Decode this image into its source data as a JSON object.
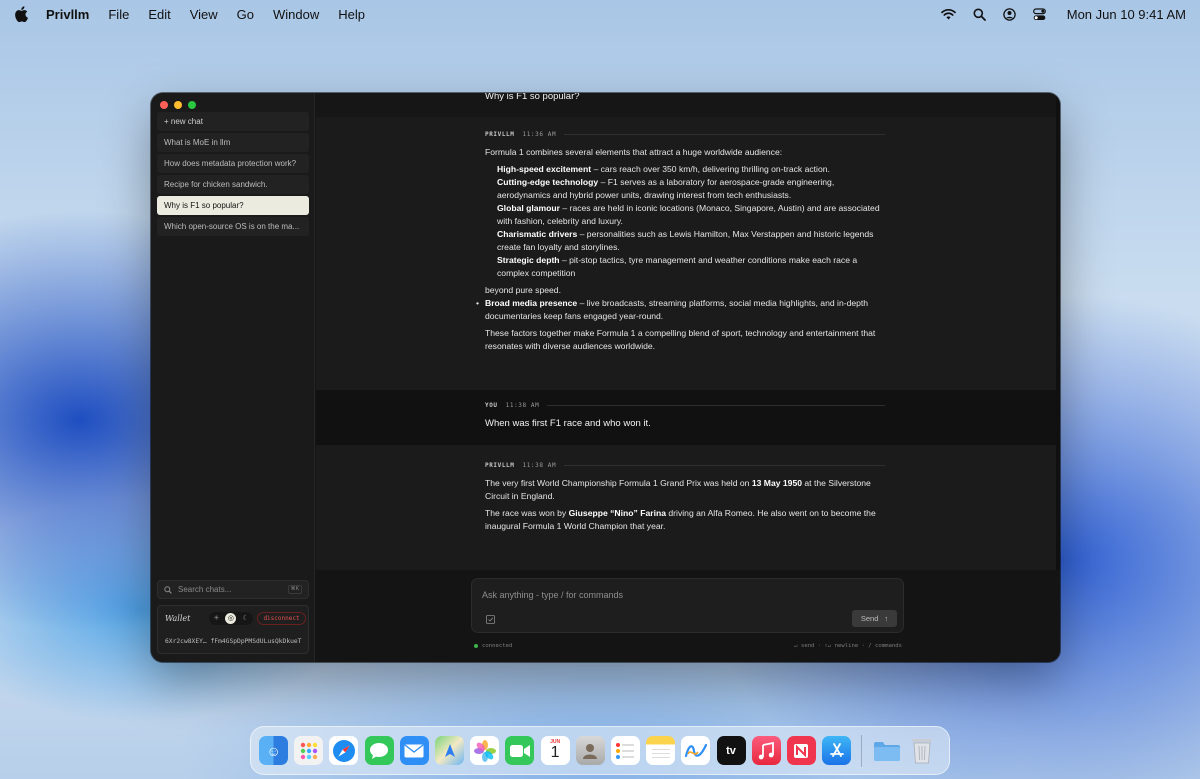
{
  "menubar": {
    "app_name": "Privllm",
    "menus": [
      "File",
      "Edit",
      "View",
      "Go",
      "Window",
      "Help"
    ],
    "clock": "Mon Jun 10  9:41 AM"
  },
  "sidebar": {
    "new_chat": "+ new chat",
    "chats": [
      "What is MoE in llm",
      "How does metadata protection work?",
      "Recipe for chicken sandwich.",
      "Why is F1 so popular?",
      "Which open-source OS is on the ma..."
    ],
    "active_index": 3,
    "search_placeholder": "Search chats...",
    "search_shortcut": "⌘K",
    "wallet": {
      "label": "Wallet",
      "disconnect": "disconnect",
      "address": "6Xr2cw8XEY… fFm4GSpDpPMSdULusQkDkueT"
    }
  },
  "conversation": {
    "top_user_message": "Why is F1 so popular?",
    "ai1": {
      "sender": "PRIVLLM",
      "time": "11:36 AM",
      "intro": "Formula 1 combines several elements that attract a huge worldwide audience:",
      "points": [
        {
          "title": "High-speed excitement",
          "text": " – cars reach over 350 km/h, delivering thrilling on-track action."
        },
        {
          "title": "Cutting-edge technology",
          "text": " – F1 serves as a laboratory for aerospace-grade engineering, aerodynamics and hybrid power units, drawing interest from tech enthusiasts."
        },
        {
          "title": "Global glamour",
          "text": " – races are held in iconic locations (Monaco, Singapore, Austin) and are associated with fashion, celebrity and luxury."
        },
        {
          "title": "Charismatic drivers",
          "text": " – personalities such as Lewis Hamilton, Max Verstappen and historic legends create fan loyalty and storylines."
        },
        {
          "title": "Strategic depth",
          "text": " – pit-stop tactics, tyre management and weather conditions make each race a complex competition"
        }
      ],
      "after": "beyond pure speed.",
      "bullet_title": "Broad media presence",
      "bullet_text": " – live broadcasts, streaming platforms, social media highlights, and in-depth documentaries keep fans engaged year-round.",
      "closing": "These factors together make Formula 1 a compelling blend of sport, technology and entertainment that resonates with diverse audiences worldwide."
    },
    "user2": {
      "sender": "YOU",
      "time": "11:38 AM",
      "text": "When was first F1 race and who won it."
    },
    "ai2": {
      "sender": "PRIVLLM",
      "time": "11:38 AM",
      "p1_a": "The very first World Championship Formula 1 Grand Prix was held on ",
      "p1_bold": "13 May 1950",
      "p1_b": " at the Silverstone Circuit in England.",
      "p2_a": "The race was won by ",
      "p2_bold": "Giuseppe “Nino” Farina",
      "p2_b": " driving an Alfa Romeo. He also went on to become the inaugural Formula 1 World Champion that year."
    }
  },
  "composer": {
    "placeholder": "Ask anything - type / for commands",
    "send": "Send",
    "send_arrow": "↑"
  },
  "status": {
    "connection": "connected",
    "hints": "↵ send · ⇧↵ newline · / commands"
  },
  "dock": {
    "apps": [
      "finder",
      "launchpad",
      "safari",
      "messages",
      "mail",
      "maps",
      "photos",
      "facetime",
      "calendar",
      "contacts",
      "reminders",
      "notes",
      "freeform",
      "tv",
      "music",
      "news",
      "app-store"
    ],
    "calendar_month": "JUN",
    "calendar_day": "1",
    "tv_label": "tv"
  },
  "colors": {
    "accent_active_chat": "#ecebdf",
    "disconnect": "#e0524f",
    "connected_dot": "#3cb44b"
  }
}
